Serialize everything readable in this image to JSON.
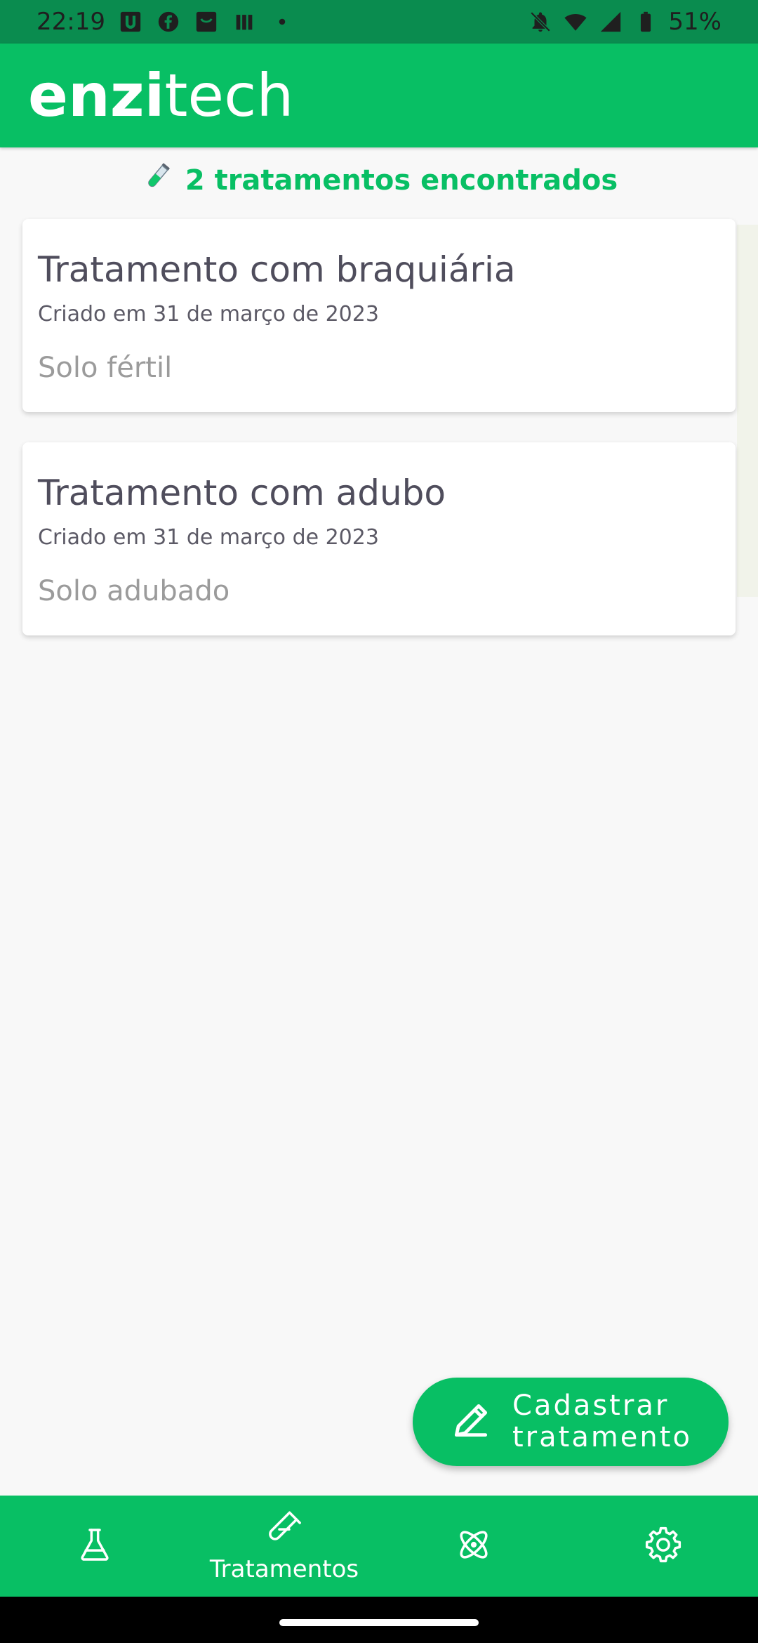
{
  "status_bar": {
    "time": "22:19",
    "battery": "51%",
    "left_icons": [
      "u-app-icon",
      "facebook-icon",
      "app-icon",
      "signal-bars-icon",
      "dot-icon"
    ],
    "right_icons": [
      "bell-off-icon",
      "wifi-icon",
      "cell-signal-icon",
      "battery-icon"
    ]
  },
  "app_bar": {
    "brand_bold": "enzi",
    "brand_regular": "tech"
  },
  "list_header": {
    "icon": "test-tube-icon",
    "text": "2 tratamentos encontrados"
  },
  "treatments": [
    {
      "title": "Tratamento com braquiária",
      "created": "Criado em 31 de março de 2023",
      "description": "Solo fértil"
    },
    {
      "title": "Tratamento com adubo",
      "created": "Criado em 31 de março de 2023",
      "description": "Solo adubado"
    }
  ],
  "fab": {
    "icon": "pencil-icon",
    "label_line1": "Cadastrar",
    "label_line2": "tratamento"
  },
  "bottom_nav": {
    "items": [
      {
        "icon": "flask-icon",
        "label": ""
      },
      {
        "icon": "test-tube-icon",
        "label": "Tratamentos",
        "active": true
      },
      {
        "icon": "atom-icon",
        "label": ""
      },
      {
        "icon": "gear-icon",
        "label": ""
      }
    ]
  },
  "colors": {
    "primary": "#08bf64",
    "status_bar": "#0a8c4f",
    "title_text": "#4f4d5c",
    "muted_text": "#9b9b9b"
  }
}
